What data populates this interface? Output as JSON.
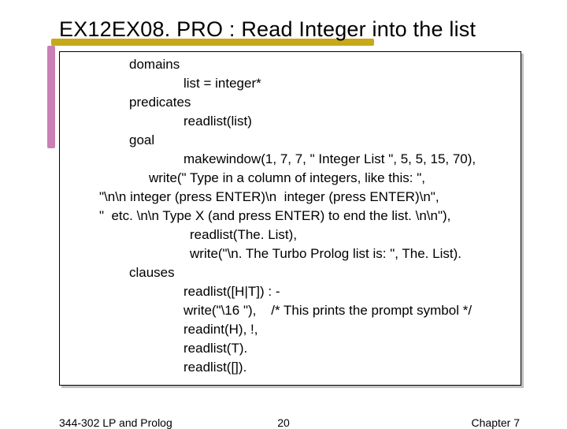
{
  "title": "EX12EX08. PRO : Read Integer into the list",
  "lines": {
    "l1": "domains",
    "l2": "list = integer*",
    "l3": "predicates",
    "l4": "readlist(list)",
    "l5": "goal",
    "l6": "makewindow(1, 7, 7, \" Integer List \", 5, 5, 15, 70),",
    "l7": "write(\" Type in a column of integers, like this: \",",
    "l8": "\"\\n\\n integer (press ENTER)\\n  integer (press ENTER)\\n\",",
    "l9": "\"  etc. \\n\\n Type X (and press ENTER) to end the list. \\n\\n\"),",
    "l10": "readlist(The. List),",
    "l11": "write(\"\\n. The Turbo Prolog list is: \", The. List).",
    "l12": "clauses",
    "l13": "readlist([H|T]) : -",
    "l14": "write(\"\\16 \"),    /* This prints the prompt symbol */",
    "l15": "readint(H), !,",
    "l16": "readlist(T).",
    "l17": "readlist([])."
  },
  "footer": {
    "left": "344-302 LP and Prolog",
    "center": "20",
    "right": "Chapter 7"
  }
}
